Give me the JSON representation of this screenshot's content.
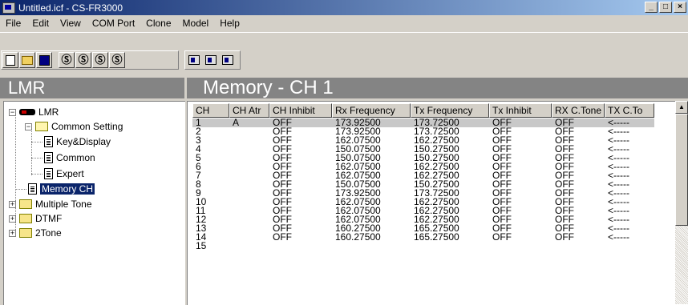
{
  "window": {
    "title": "Untitled.icf - CS-FR3000",
    "minimize": "_",
    "maximize": "□",
    "close": "×"
  },
  "menu": [
    {
      "label": "File",
      "key": "F"
    },
    {
      "label": "Edit",
      "key": "E"
    },
    {
      "label": "View",
      "key": "V"
    },
    {
      "label": "COM Port",
      "key": "P"
    },
    {
      "label": "Clone",
      "key": "C"
    },
    {
      "label": "Model",
      "key": "M"
    },
    {
      "label": "Help",
      "key": "H"
    }
  ],
  "toolbar": {
    "file_icons": [
      "new-file-icon",
      "open-folder-icon",
      "save-disk-icon"
    ],
    "clone_icons": [
      "clone-read-icon",
      "clone-write-icon",
      "clone-read2-icon",
      "clone-write2-icon"
    ],
    "clone_glyphs": [
      "Ⓢ",
      "Ⓢ",
      "Ⓢ",
      "Ⓢ"
    ],
    "device_icons": [
      "device-icon",
      "device-transfer-icon",
      "device-info-icon"
    ]
  },
  "left_header": "LMR",
  "right_header": "Memory  -  CH 1",
  "tree": {
    "root": "LMR",
    "common_setting": "Common Setting",
    "key_display": "Key&Display",
    "common": "Common",
    "expert": "Expert",
    "memory_ch": "Memory CH",
    "multiple_tone": "Multiple Tone",
    "dtmf": "DTMF",
    "two_tone": "2Tone"
  },
  "grid": {
    "columns": [
      "CH",
      "CH Atr",
      "CH Inhibit",
      "Rx Frequency",
      "Tx Frequency",
      "Tx Inhibit",
      "RX C.Tone",
      "TX C.To"
    ],
    "rows": [
      [
        "1",
        "A",
        "OFF",
        "173.92500",
        "173.72500",
        "OFF",
        "OFF",
        "<-----"
      ],
      [
        "2",
        "",
        "OFF",
        "173.92500",
        "173.72500",
        "OFF",
        "OFF",
        "<-----"
      ],
      [
        "3",
        "",
        "OFF",
        "162.07500",
        "162.27500",
        "OFF",
        "OFF",
        "<-----"
      ],
      [
        "4",
        "",
        "OFF",
        "150.07500",
        "150.27500",
        "OFF",
        "OFF",
        "<-----"
      ],
      [
        "5",
        "",
        "OFF",
        "150.07500",
        "150.27500",
        "OFF",
        "OFF",
        "<-----"
      ],
      [
        "6",
        "",
        "OFF",
        "162.07500",
        "162.27500",
        "OFF",
        "OFF",
        "<-----"
      ],
      [
        "7",
        "",
        "OFF",
        "162.07500",
        "162.27500",
        "OFF",
        "OFF",
        "<-----"
      ],
      [
        "8",
        "",
        "OFF",
        "150.07500",
        "150.27500",
        "OFF",
        "OFF",
        "<-----"
      ],
      [
        "9",
        "",
        "OFF",
        "173.92500",
        "173.72500",
        "OFF",
        "OFF",
        "<-----"
      ],
      [
        "10",
        "",
        "OFF",
        "162.07500",
        "162.27500",
        "OFF",
        "OFF",
        "<-----"
      ],
      [
        "11",
        "",
        "OFF",
        "162.07500",
        "162.27500",
        "OFF",
        "OFF",
        "<-----"
      ],
      [
        "12",
        "",
        "OFF",
        "162.07500",
        "162.27500",
        "OFF",
        "OFF",
        "<-----"
      ],
      [
        "13",
        "",
        "OFF",
        "160.27500",
        "165.27500",
        "OFF",
        "OFF",
        "<-----"
      ],
      [
        "14",
        "",
        "OFF",
        "160.27500",
        "165.27500",
        "OFF",
        "OFF",
        "<-----"
      ],
      [
        "15",
        "",
        "",
        "",
        "",
        "",
        "",
        ""
      ]
    ]
  }
}
